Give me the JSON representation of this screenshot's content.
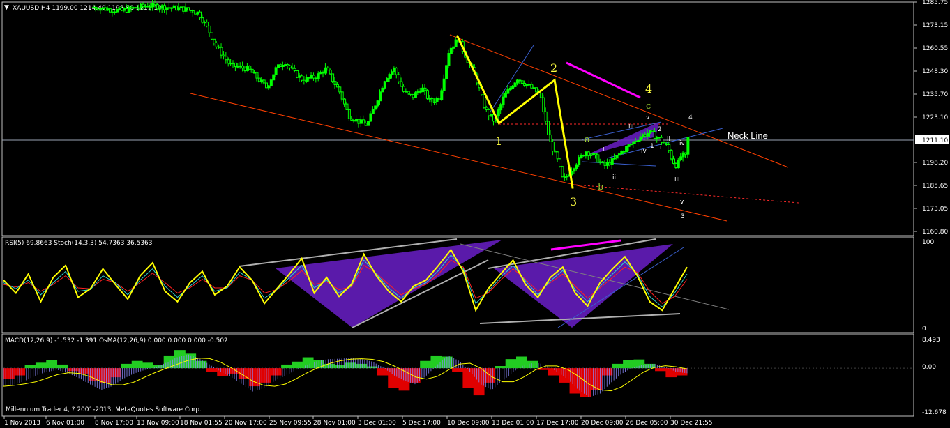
{
  "main_panel": {
    "header": "XAUUSD,H4  1199.00 1214.40 1198.80 1211.10",
    "current_price": "1211.10",
    "neck_line_label": "Neck Line",
    "copyright": "Millennium Trader 4, ? 2001-2013, MetaQuotes Software Corp."
  },
  "rsi_panel": {
    "header": "RSI(5) 69.8663  Stoch(14,3,3) 54.7363 36.5363",
    "scale_top": "100",
    "scale_bottom": "0"
  },
  "macd_panel": {
    "header": "MACD(12,26,9) -1.532 -1.391  OsMA(12,26,9) 0.000 0.000 0.000 -0.502",
    "scale_top": "8.493",
    "scale_mid": "0.00",
    "scale_bottom": "-12.678"
  },
  "wave_labels": {
    "w1": "1",
    "w2": "2",
    "w3": "3",
    "w4": "4",
    "wa": "a",
    "wb": "b",
    "wc": "c",
    "s_i": "i",
    "s_ii": "ii",
    "s_iii": "iii",
    "s_iv": "iv",
    "s_v": "v",
    "b1": "1",
    "b2": "2",
    "b3": "3",
    "b4": "4",
    "r_i": "i",
    "r_ii": "ii",
    "r_iii": "iii",
    "r_iv": "iv",
    "r_v": "v"
  },
  "colors": {
    "background": "#000000",
    "frame": "#c0c0c0",
    "bull_candle": "#00ff00",
    "channel": "#ff4000",
    "wave_path": "#ffff00",
    "triangle_fill": "#6a1ec8",
    "magenta": "#ff00ff",
    "osma_pos": "#22cc22",
    "osma_neg": "#e00000",
    "macd_hist": "#8c8cff",
    "signal": "#ffff00"
  },
  "chart_data": [
    {
      "type": "candlestick",
      "symbol": "XAUUSD",
      "timeframe": "H4",
      "ylim": [
        1160.8,
        1285.75
      ],
      "y_ticks": [
        "1285.75",
        "1273.15",
        "1260.55",
        "1248.30",
        "1235.70",
        "1223.10",
        "1211.10",
        "1198.20",
        "1185.65",
        "1173.05",
        "1160.80"
      ],
      "x_ticks": [
        "1 Nov 2013",
        "6 Nov 01:00",
        "8 Nov 17:00",
        "13 Nov 09:00",
        "18 Nov 01:55",
        "20 Nov 17:00",
        "25 Nov 09:55",
        "28 Nov 01:00",
        "3 Dec 01:00",
        "5 Dec 17:00",
        "10 Dec 09:00",
        "13 Dec 01:00",
        "17 Dec 17:00",
        "20 Dec 09:00",
        "26 Dec 05:00",
        "30 Dec 21:55"
      ],
      "close_path": [
        [
          0.1,
          1283
        ],
        [
          0.13,
          1281
        ],
        [
          0.16,
          1284
        ],
        [
          0.18,
          1283
        ],
        [
          0.2,
          1282
        ],
        [
          0.215,
          1280
        ],
        [
          0.225,
          1272
        ],
        [
          0.235,
          1262
        ],
        [
          0.25,
          1252
        ],
        [
          0.27,
          1250
        ],
        [
          0.28,
          1245
        ],
        [
          0.29,
          1240
        ],
        [
          0.3,
          1250
        ],
        [
          0.31,
          1254
        ],
        [
          0.32,
          1248
        ],
        [
          0.33,
          1244
        ],
        [
          0.345,
          1246
        ],
        [
          0.355,
          1250
        ],
        [
          0.37,
          1238
        ],
        [
          0.38,
          1225
        ],
        [
          0.39,
          1222
        ],
        [
          0.4,
          1220
        ],
        [
          0.41,
          1232
        ],
        [
          0.42,
          1245
        ],
        [
          0.43,
          1250
        ],
        [
          0.44,
          1238
        ],
        [
          0.45,
          1235
        ],
        [
          0.46,
          1240
        ],
        [
          0.47,
          1232
        ],
        [
          0.48,
          1235
        ],
        [
          0.49,
          1260
        ],
        [
          0.5,
          1266
        ],
        [
          0.51,
          1255
        ],
        [
          0.52,
          1245
        ],
        [
          0.53,
          1228
        ],
        [
          0.54,
          1222
        ],
        [
          0.55,
          1235
        ],
        [
          0.565,
          1245
        ],
        [
          0.58,
          1240
        ],
        [
          0.59,
          1236
        ],
        [
          0.6,
          1212
        ],
        [
          0.61,
          1200
        ],
        [
          0.615,
          1190
        ],
        [
          0.62,
          1193
        ],
        [
          0.63,
          1200
        ],
        [
          0.64,
          1206
        ],
        [
          0.65,
          1203
        ],
        [
          0.66,
          1198
        ],
        [
          0.67,
          1201
        ],
        [
          0.68,
          1206
        ],
        [
          0.69,
          1210
        ],
        [
          0.7,
          1214
        ],
        [
          0.705,
          1215
        ],
        [
          0.71,
          1216
        ],
        [
          0.72,
          1213
        ],
        [
          0.73,
          1208
        ],
        [
          0.735,
          1201
        ],
        [
          0.74,
          1198
        ],
        [
          0.745,
          1204
        ],
        [
          0.75,
          1203
        ],
        [
          0.752,
          1213
        ]
      ],
      "wave_pivots": [
        [
          0.499,
          1268
        ],
        [
          0.545,
          1221
        ],
        [
          0.606,
          1244
        ],
        [
          0.626,
          1186
        ]
      ],
      "neck_line_value": 1211.1
    },
    {
      "type": "line",
      "title": "RSI(5) / Stoch(14,3,3)",
      "ylim": [
        0,
        100
      ],
      "series": [
        {
          "name": "RSI(5)",
          "values": [
            55,
            40,
            62,
            30,
            58,
            72,
            35,
            45,
            68,
            50,
            33,
            60,
            75,
            42,
            30,
            52,
            65,
            38,
            48,
            70,
            55,
            28,
            45,
            62,
            80,
            40,
            58,
            36,
            50,
            85,
            60,
            42,
            30,
            48,
            55,
            72,
            90,
            65,
            20,
            45,
            62,
            78,
            50,
            35,
            58,
            70,
            40,
            25,
            52,
            68,
            82,
            60,
            30,
            20,
            45,
            70
          ]
        },
        {
          "name": "Main",
          "values": [
            52,
            45,
            55,
            38,
            52,
            65,
            42,
            44,
            60,
            52,
            38,
            55,
            68,
            48,
            35,
            48,
            60,
            42,
            46,
            64,
            55,
            34,
            44,
            58,
            72,
            46,
            55,
            40,
            48,
            78,
            62,
            46,
            34,
            46,
            52,
            66,
            84,
            68,
            28,
            42,
            58,
            72,
            54,
            38,
            54,
            66,
            44,
            30,
            48,
            62,
            76,
            62,
            36,
            24,
            40,
            62
          ]
        },
        {
          "name": "Signal",
          "values": [
            50,
            47,
            52,
            42,
            50,
            60,
            46,
            45,
            56,
            52,
            42,
            52,
            63,
            52,
            40,
            46,
            56,
            46,
            46,
            60,
            55,
            40,
            44,
            54,
            66,
            50,
            53,
            44,
            47,
            72,
            63,
            50,
            38,
            45,
            50,
            62,
            78,
            70,
            34,
            40,
            55,
            68,
            56,
            42,
            52,
            62,
            48,
            34,
            46,
            58,
            70,
            64,
            42,
            28,
            36,
            56
          ]
        }
      ]
    },
    {
      "type": "bar",
      "title": "MACD(12,26,9) / OsMA(12,26,9)",
      "ylim": [
        -12.678,
        8.493
      ],
      "series": [
        {
          "name": "OsMA",
          "values": [
            -3,
            -2,
            0.8,
            1.5,
            2.2,
            1.0,
            -0.8,
            -1.5,
            -3.5,
            -4,
            -2.5,
            1.2,
            2,
            1.5,
            0.9,
            3.5,
            5,
            4,
            2,
            -1,
            -2.2,
            -1.5,
            -3,
            -5,
            -4,
            -2,
            1,
            1.8,
            3,
            2.2,
            1.2,
            0.8,
            1.5,
            1.2,
            0.5,
            -2,
            -5.5,
            -6.2,
            -4,
            2,
            3.5,
            3.2,
            -1,
            -5.5,
            -7.5,
            -4,
            0.6,
            2.5,
            3.2,
            2,
            -0.5,
            -2,
            -4,
            -7,
            -8,
            -6,
            -2,
            1.2,
            2.2,
            2.4,
            1.2,
            -0.8,
            -2.5,
            -2
          ]
        },
        {
          "name": "MACD",
          "values": [
            -5,
            -4.5,
            -3.5,
            -2,
            -1,
            -0.5,
            -1.5,
            -2.8,
            -4.5,
            -6,
            -5,
            -3,
            -1.5,
            -0.5,
            0.3,
            1.5,
            3,
            3.8,
            2.8,
            1,
            -1,
            -2.5,
            -4.5,
            -6.5,
            -5.5,
            -3.5,
            -2,
            -0.5,
            1,
            2,
            2.5,
            2.6,
            2.8,
            2.5,
            1.8,
            0.2,
            -2,
            -3.5,
            -4.5,
            -2,
            1,
            3.5,
            2,
            -1,
            -4.5,
            -6,
            -3.5,
            -1,
            1,
            1.5,
            1,
            -1,
            -3,
            -6,
            -8,
            -7,
            -4,
            -1.5,
            0.2,
            1,
            1.2,
            0.3,
            -1,
            -1.4
          ]
        }
      ]
    }
  ]
}
